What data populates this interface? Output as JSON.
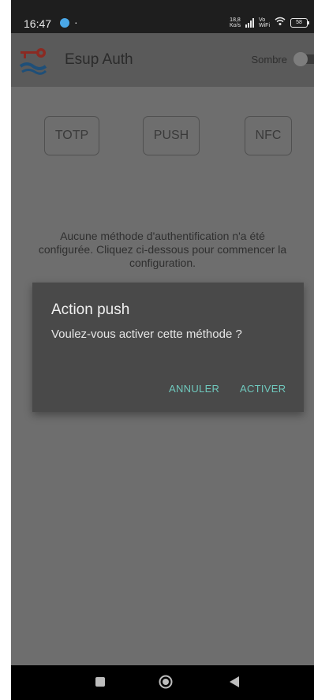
{
  "status_bar": {
    "time": "16:47",
    "dot": "·",
    "net_speed_value": "18,8",
    "net_speed_unit": "Ko/s",
    "vowifi_top": "Vo",
    "vowifi_bottom": "WiFi",
    "battery": "58"
  },
  "app_bar": {
    "title": "Esup Auth",
    "theme_toggle_label": "Sombre",
    "theme_toggle_on": false
  },
  "methods": {
    "totp": "TOTP",
    "push": "PUSH",
    "nfc": "NFC"
  },
  "info_text": "Aucune méthode d'authentification n'a été configurée. Cliquez ci-dessous pour commencer la configuration.",
  "dialog": {
    "title": "Action push",
    "message": "Voulez-vous activer cette méthode ?",
    "cancel_label": "ANNULER",
    "confirm_label": "ACTIVER"
  },
  "colors": {
    "dialog_accent": "#6fc7bc",
    "logo_red": "#c0392b",
    "logo_blue": "#1f6fa8"
  },
  "icons": {
    "status_app": "blue-dot-icon",
    "signal": "signal-icon",
    "wifi": "wifi-icon",
    "battery": "battery-icon",
    "logo": "key-wave-logo",
    "nav_recents": "square-icon",
    "nav_home": "circle-icon",
    "nav_back": "triangle-back-icon"
  }
}
